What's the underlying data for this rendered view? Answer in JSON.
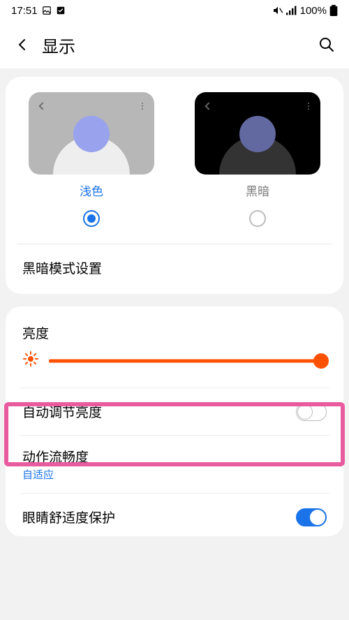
{
  "status": {
    "time": "17:51",
    "battery": "100%"
  },
  "header": {
    "title": "显示"
  },
  "theme": {
    "light_label": "浅色",
    "dark_label": "黑暗",
    "selected": "light"
  },
  "dark_mode_settings_label": "黑暗模式设置",
  "brightness": {
    "label": "亮度",
    "value_pct": 98
  },
  "auto_brightness": {
    "label": "自动调节亮度",
    "enabled": false
  },
  "motion_smoothness": {
    "label": "动作流畅度",
    "sub": "自适应"
  },
  "eye_comfort": {
    "label": "眼睛舒适度保护",
    "enabled": true
  },
  "annotation": {
    "highlight_target": "auto_brightness"
  }
}
